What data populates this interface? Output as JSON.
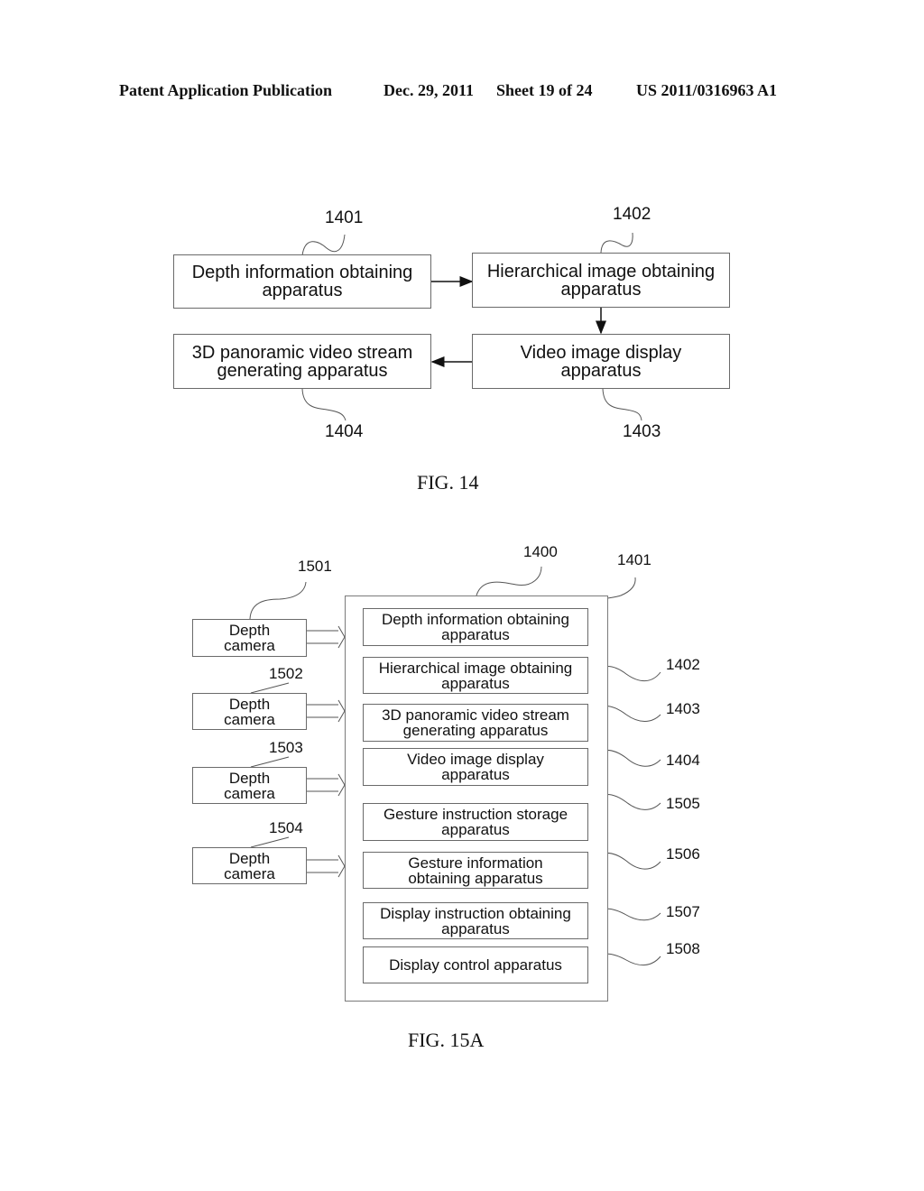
{
  "header": {
    "publication_type": "Patent Application Publication",
    "date": "Dec. 29, 2011",
    "sheet": "Sheet 19 of 24",
    "publication_number": "US 2011/0316963 A1"
  },
  "fig14": {
    "caption": "FIG. 14",
    "blocks": [
      {
        "ref": "1401",
        "line1": "Depth information obtaining",
        "line2": "apparatus"
      },
      {
        "ref": "1402",
        "line1": "Hierarchical image obtaining",
        "line2": "apparatus"
      },
      {
        "ref": "1403",
        "line1": "Video image display",
        "line2": "apparatus"
      },
      {
        "ref": "1404",
        "line1": "3D panoramic video stream",
        "line2": "generating apparatus"
      }
    ],
    "flow": [
      "1401 -> 1402",
      "1402 -> 1403",
      "1403 -> 1404"
    ]
  },
  "fig15a": {
    "caption": "FIG. 15A",
    "system_ref": "1400",
    "cameras": [
      {
        "ref": "1501",
        "line1": "Depth",
        "line2": "camera"
      },
      {
        "ref": "1502",
        "line1": "Depth",
        "line2": "camera"
      },
      {
        "ref": "1503",
        "line1": "Depth",
        "line2": "camera"
      },
      {
        "ref": "1504",
        "line1": "Depth",
        "line2": "camera"
      }
    ],
    "modules": [
      {
        "ref": "1401",
        "line1": "Depth information obtaining",
        "line2": "apparatus"
      },
      {
        "ref": "1402",
        "line1": "Hierarchical image obtaining",
        "line2": "apparatus"
      },
      {
        "ref": "1403",
        "line1": "3D panoramic video stream",
        "line2": "generating apparatus"
      },
      {
        "ref": "1404",
        "line1": "Video image display",
        "line2": "apparatus"
      },
      {
        "ref": "1505",
        "line1": "Gesture instruction storage",
        "line2": "apparatus"
      },
      {
        "ref": "1506",
        "line1": "Gesture information",
        "line2": "obtaining apparatus"
      },
      {
        "ref": "1507",
        "line1": "Display instruction obtaining",
        "line2": "apparatus"
      },
      {
        "ref": "1508",
        "line1": "Display control apparatus",
        "line2": ""
      }
    ]
  }
}
